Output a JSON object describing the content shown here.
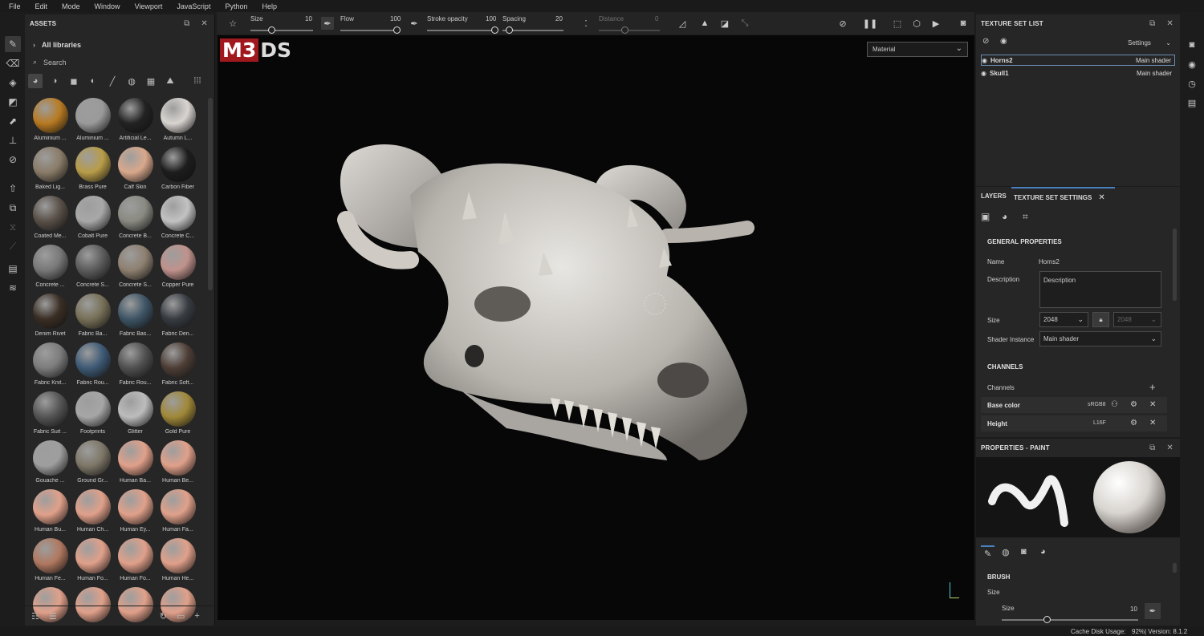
{
  "menu": [
    "File",
    "Edit",
    "Mode",
    "Window",
    "Viewport",
    "JavaScript",
    "Python",
    "Help"
  ],
  "assets": {
    "title": "ASSETS",
    "all_libraries": "All libraries",
    "search_placeholder": "Search",
    "materials": [
      {
        "label": "Aluminium ...",
        "color": "#b87a22"
      },
      {
        "label": "Aluminium ...",
        "color": "#9a9a9a"
      },
      {
        "label": "Artificial Le...",
        "color": "#222222"
      },
      {
        "label": "Autumn L...",
        "color": "#d8d4d0"
      },
      {
        "label": "Baked Lig...",
        "color": "#8a7c68"
      },
      {
        "label": "Brass Pure",
        "color": "#b89c48"
      },
      {
        "label": "Calf Skin",
        "color": "#d9a88c"
      },
      {
        "label": "Carbon Fiber",
        "color": "#1d1d1d"
      },
      {
        "label": "Coated Me...",
        "color": "#595048"
      },
      {
        "label": "Cobalt Pure",
        "color": "#a8a8a8"
      },
      {
        "label": "Concrete B...",
        "color": "#8a8a82"
      },
      {
        "label": "Concrete C...",
        "color": "#c2c2c2"
      },
      {
        "label": "Concrete ...",
        "color": "#787878"
      },
      {
        "label": "Concrete S...",
        "color": "#5c5c5c"
      },
      {
        "label": "Concrete S...",
        "color": "#8e8070"
      },
      {
        "label": "Copper Pure",
        "color": "#c0928c"
      },
      {
        "label": "Denim Rivet",
        "color": "#3a2e24"
      },
      {
        "label": "Fabric Ba...",
        "color": "#777058"
      },
      {
        "label": "Fabric Bas...",
        "color": "#3e5566"
      },
      {
        "label": "Fabric Den...",
        "color": "#373c42"
      },
      {
        "label": "Fabric Knit...",
        "color": "#7c7c7c"
      },
      {
        "label": "Fabric Rou...",
        "color": "#3e5a75"
      },
      {
        "label": "Fabric Rou...",
        "color": "#505050"
      },
      {
        "label": "Fabric Soft...",
        "color": "#4d3e36"
      },
      {
        "label": "Fabric Suit ...",
        "color": "#555555"
      },
      {
        "label": "Footprints",
        "color": "#a6a6a6"
      },
      {
        "label": "Glitter",
        "color": "#bcbcbc"
      },
      {
        "label": "Gold Pure",
        "color": "#a08838"
      },
      {
        "label": "Gouache ...",
        "color": "#9e9e9e"
      },
      {
        "label": "Ground Gr...",
        "color": "#7e7768"
      },
      {
        "label": "Human Ba...",
        "color": "#e0a08a"
      },
      {
        "label": "Human Be...",
        "color": "#e0a08a"
      },
      {
        "label": "Human Bu...",
        "color": "#e0a08a"
      },
      {
        "label": "Human Ch...",
        "color": "#e0a08a"
      },
      {
        "label": "Human Ey...",
        "color": "#e0a08a"
      },
      {
        "label": "Human Fa...",
        "color": "#e0a08a"
      },
      {
        "label": "Human Fe...",
        "color": "#b07860"
      },
      {
        "label": "Human Fo...",
        "color": "#e0a08a"
      },
      {
        "label": "Human Fo...",
        "color": "#e0a08a"
      },
      {
        "label": "Human He...",
        "color": "#e0a08a"
      },
      {
        "label": "",
        "color": "#e0a08a"
      },
      {
        "label": "",
        "color": "#e0a08a"
      },
      {
        "label": "",
        "color": "#e0a08a"
      },
      {
        "label": "",
        "color": "#e0a08a"
      }
    ]
  },
  "toolbar": {
    "size_label": "Size",
    "size_value": "10",
    "flow_label": "Flow",
    "flow_value": "100",
    "stroke_opacity_label": "Stroke opacity",
    "stroke_opacity_value": "100",
    "spacing_label": "Spacing",
    "spacing_value": "20",
    "distance_label": "Distance",
    "distance_value": "0"
  },
  "viewport": {
    "logo_left": "M3",
    "logo_right": "DS",
    "material_mode": "Material"
  },
  "texture_set_list": {
    "title": "TEXTURE SET LIST",
    "settings_label": "Settings",
    "sets": [
      {
        "name": "Horns2",
        "shader": "Main shader"
      },
      {
        "name": "Skull1",
        "shader": "Main shader"
      }
    ]
  },
  "layers": {
    "tab_layers": "LAYERS",
    "tab_tss": "TEXTURE SET SETTINGS",
    "general_properties": "GENERAL PROPERTIES",
    "name_label": "Name",
    "name_value": "Horns2",
    "description_label": "Description",
    "description_value": "Description",
    "size_label": "Size",
    "size_value": "2048",
    "size_value_locked": "2048",
    "shader_instance_label": "Shader Instance",
    "shader_instance_value": "Main shader",
    "channels_title": "CHANNELS",
    "channels_label": "Channels",
    "channels": [
      {
        "name": "Base color",
        "format": "sRGB8"
      },
      {
        "name": "Height",
        "format": "L16F"
      }
    ]
  },
  "properties": {
    "title": "PROPERTIES - PAINT",
    "brush_title": "BRUSH",
    "size_label": "Size",
    "size_sub_label": "Size",
    "size_value": "10",
    "size_fraction": 0.33
  },
  "status": {
    "cache_label": "Cache Disk Usage:",
    "cache_value": "92%",
    "version": "| Version: 8.1.2"
  }
}
